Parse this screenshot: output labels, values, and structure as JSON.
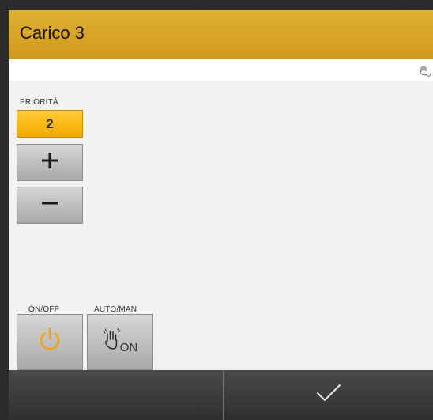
{
  "header": {
    "title": "Carico 3"
  },
  "status": {
    "mode_icon": "manual-hand-icon"
  },
  "priority": {
    "label": "PRIORITÀ",
    "value": "2"
  },
  "controls": {
    "increase_icon": "plus-icon",
    "decrease_icon": "minus-icon",
    "onoff_label": "ON/OFF",
    "power_icon": "power-icon",
    "power_color": "#f5a300",
    "automan_label": "AUTO/MAN",
    "mode_state": "ON",
    "mode_icon": "hand-icon"
  },
  "footer": {
    "confirm_icon": "checkmark-icon"
  },
  "colors": {
    "accent": "#d9a52a",
    "highlight": "#f7b400",
    "button": "#bdbdbd",
    "footer": "#3a3a3a"
  }
}
